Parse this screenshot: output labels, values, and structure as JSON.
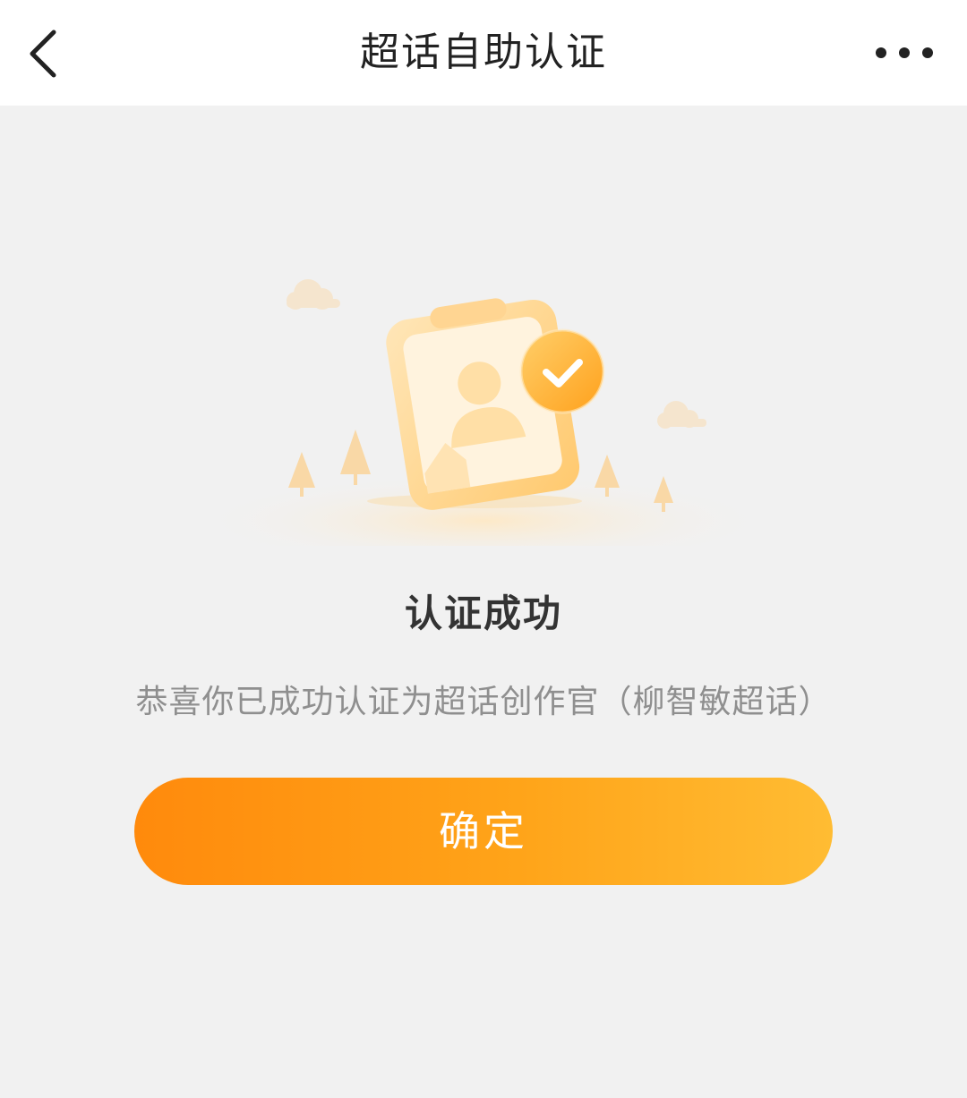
{
  "navbar": {
    "title": "超话自助认证",
    "back_icon": "chevron-left-icon",
    "more_icon": "more-horizontal-icon"
  },
  "result": {
    "title": "认证成功",
    "description": "恭喜你已成功认证为超话创作官（柳智敏超话）",
    "illustration_icon": "id-card-verified-icon"
  },
  "actions": {
    "confirm_label": "确定"
  },
  "colors": {
    "accent_start": "#ff8a0c",
    "accent_end": "#ffbc33",
    "background": "#f1f1f1"
  }
}
